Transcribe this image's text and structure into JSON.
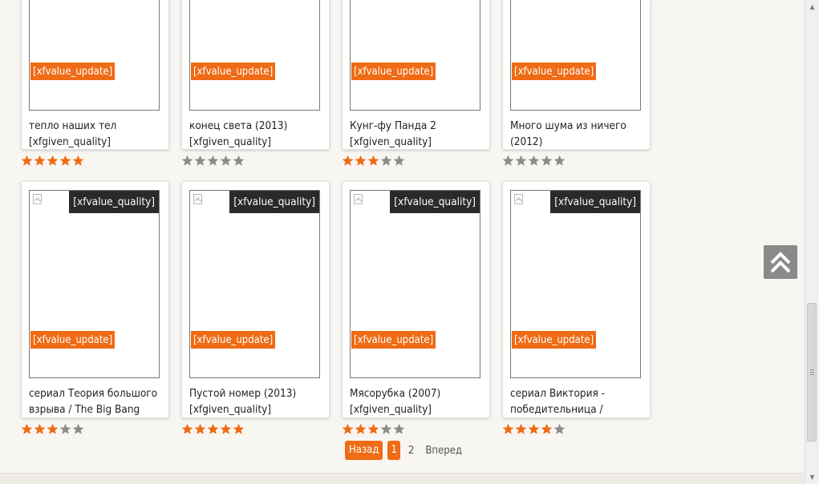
{
  "row1": [
    {
      "update": "[xfvalue_update]",
      "title1": "тепло наших тел",
      "title2": "[xfgiven_quality]",
      "rating": 5
    },
    {
      "update": "[xfvalue_update]",
      "title1": "конец света (2013)",
      "title2": "[xfgiven_quality]",
      "rating": 0
    },
    {
      "update": "[xfvalue_update]",
      "title1": "Кунг-фу Панда 2",
      "title2": "[xfgiven_quality]",
      "rating": 3
    },
    {
      "update": "[xfvalue_update]",
      "title1": "Много шума из ничего",
      "title2": "(2012)",
      "rating": 0
    }
  ],
  "row2": [
    {
      "quality": "[xfvalue_quality]",
      "update": "[xfvalue_update]",
      "title1": "сериал Теория большого",
      "title2": "взрыва / The Big Bang",
      "rating": 3
    },
    {
      "quality": "[xfvalue_quality]",
      "update": "[xfvalue_update]",
      "title1": "Пустой номер (2013)",
      "title2": "[xfgiven_quality]",
      "rating": 5
    },
    {
      "quality": "[xfvalue_quality]",
      "update": "[xfvalue_update]",
      "title1": "Мясорубка (2007)",
      "title2": "[xfgiven_quality]",
      "rating": 3
    },
    {
      "quality": "[xfvalue_quality]",
      "update": "[xfvalue_update]",
      "title1": "сериал Виктория -",
      "title2": "победительница /",
      "rating": 4
    }
  ],
  "pagination": {
    "prev": "Назад",
    "current": "1",
    "page2": "2",
    "next": "Вперед"
  },
  "colors": {
    "accent": "#ef6b15",
    "star_on": "#ef6b15",
    "star_off": "#8c8c8c",
    "quality_badge": "#2a2a2a"
  },
  "icons": {
    "scroll_top": "double-chevron-up-icon",
    "star": "star-icon"
  }
}
